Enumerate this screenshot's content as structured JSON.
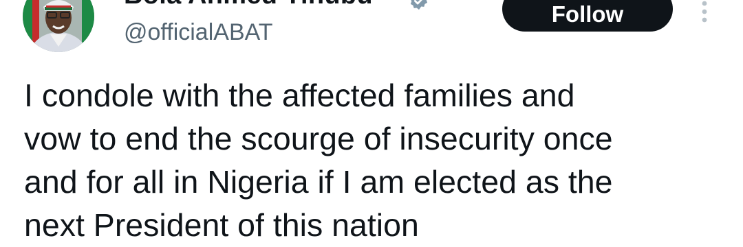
{
  "tweet": {
    "author": {
      "display_name": "Bola Ahmed Tinubu",
      "handle": "@officialABAT",
      "verified_icon": "verified-badge-icon",
      "avatar_icon": "profile-photo"
    },
    "follow_label": "Follow",
    "more_icon": "more-options-icon",
    "text": "I condole with the affected families and\nvow to end the scourge of insecurity once\nand for all in Nigeria if I am elected as the\nnext President of this nation"
  },
  "colors": {
    "text": "#0f1419",
    "secondary_text": "#536471",
    "button_bg": "#0f1419",
    "button_text": "#ffffff",
    "verified_badge": "#829aab"
  }
}
